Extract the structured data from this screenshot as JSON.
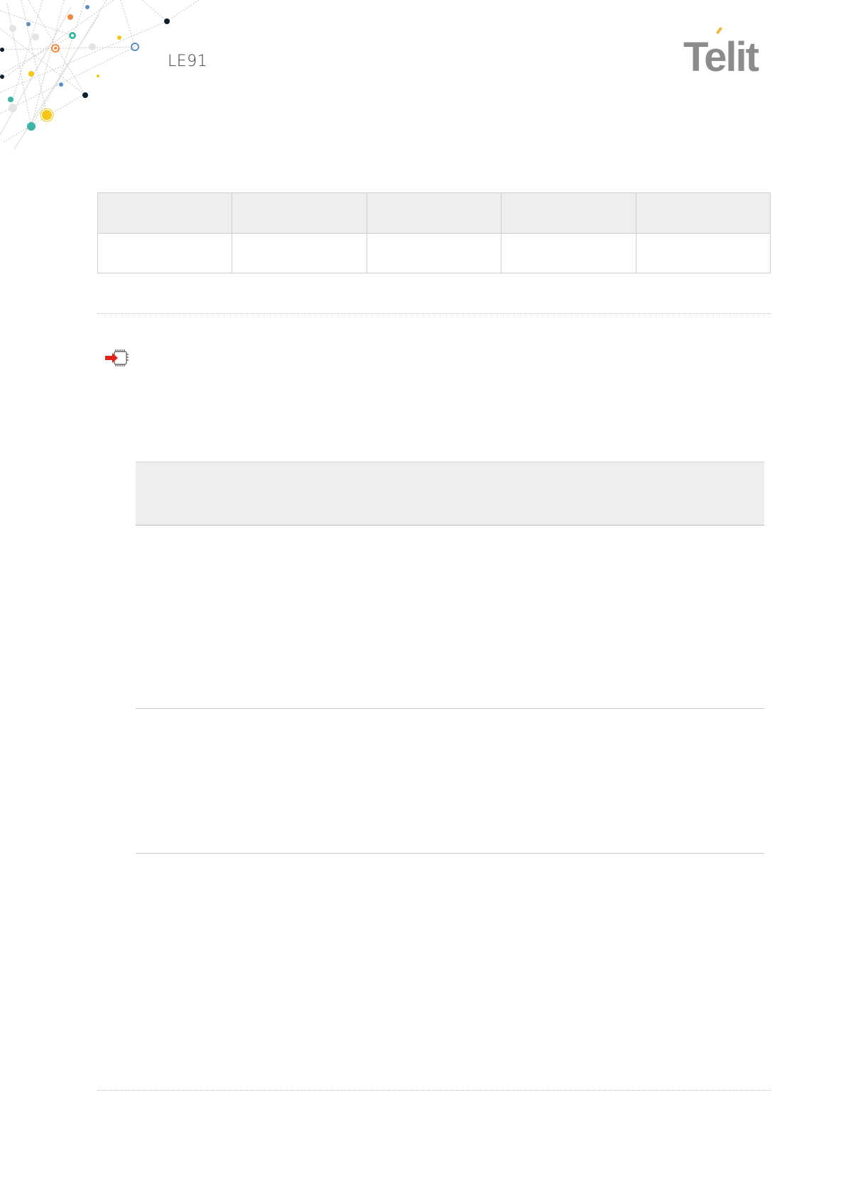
{
  "header": {
    "document_title": "LE91",
    "brand_logo_text": "Telit"
  },
  "colors": {
    "logo_gray": "#8a8c8e",
    "logo_accent": "#f2b233",
    "table_header_bg": "#eeeeee",
    "table_border": "#cfcfcf",
    "note_arrow": "#e2231a"
  },
  "icons": {
    "network_decoration": "network-graph-decoration-icon",
    "note_marker": "memory-chip-arrow-icon"
  }
}
